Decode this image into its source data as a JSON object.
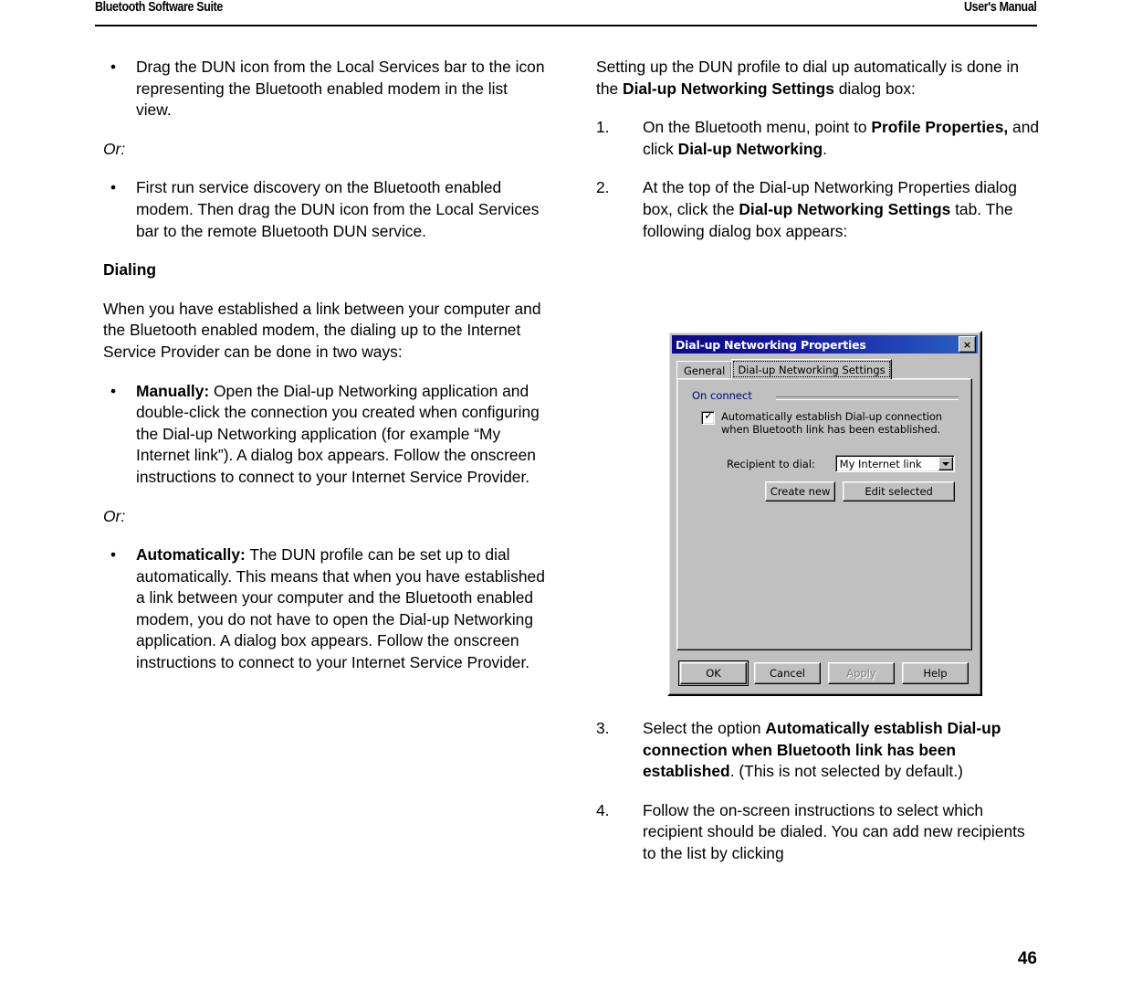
{
  "header": {
    "left_title": "Bluetooth Software Suite",
    "right_title": "User's Manual"
  },
  "left_column": {
    "bullet_1": "Drag the DUN icon from the Local Services bar to the icon representing the Bluetooth enabled modem in the list view.",
    "or_1": "Or:",
    "bullet_2": "First run service discovery on the Bluetooth enabled modem. Then drag the DUN icon from the Local Services bar to the remote Bluetooth DUN service.",
    "heading_dialing": "Dialing",
    "para_intro": "When you have established a link between your computer and the Bluetooth enabled modem, the dialing up to the Internet Service Provider can be done in two ways:",
    "bullet_manually_lead": "Manually:",
    "bullet_manually_rest": " Open the Dial-up Networking application and double-click the connection you created when configuring the Dial-up Networking application (for example “My Internet link”). A dialog box appears. Follow the onscreen instructions to connect to your Internet Service Provider.",
    "or_2": "Or:",
    "bullet_auto_lead": "Automatically:",
    "bullet_auto_rest": " The DUN profile can be set up to dial automatically. This means that when you have established a link between your computer and the Bluetooth enabled modem, you do not have to open the Dial-up Networking application. A dialog box appears. Follow the onscreen instructions to connect to your Internet Service Provider."
  },
  "right_column": {
    "para_intro_a": "Setting up the DUN profile to dial up automatically is done in the ",
    "para_intro_b": "Dial-up Networking Settings",
    "para_intro_c": " dialog box:",
    "step_1": {
      "number": "1.",
      "a": "On the Bluetooth menu, point to ",
      "b": "Profile Properties,",
      "c": " and click ",
      "d": "Dial-up Networking",
      "e": "."
    },
    "step_2": {
      "number": "2.",
      "a": "At the top of the Dial-up Networking Properties dialog box, click the ",
      "b": "Dial-up Networking Settings",
      "c": " tab. The following dialog box appears:"
    },
    "step_3": {
      "number": "3.",
      "a": "Select the option ",
      "b": "Automatically establish Dial-up connection when Bluetooth link has been established",
      "c": ". (This is not selected by default.)"
    },
    "step_4": {
      "number": "4.",
      "a": "Follow the on-screen instructions to select which recipient should be dialed. You can add new recipients to the list by clicking"
    }
  },
  "dialog": {
    "title": "Dial-up Networking Properties",
    "close_label": "×",
    "tabs": [
      {
        "label": "General",
        "selected": false
      },
      {
        "label": "Dial-up Networking Settings",
        "selected": true
      }
    ],
    "group_label": "On connect",
    "checkbox": {
      "label": "Automatically establish Dial-up connection when Bluetooth link has been established.",
      "checked": true,
      "tick": "✓"
    },
    "recipient_label": "Recipient to dial:",
    "recipient_value": "My Internet link",
    "btn_create_new": "Create new",
    "btn_edit_selected": "Edit selected",
    "btn_ok": "OK",
    "btn_cancel": "Cancel",
    "btn_apply": "Apply",
    "btn_help": "Help",
    "colors": {
      "face": "#c0c0c0",
      "titlebar_start": "#0a0a8c",
      "titlebar_end": "#2b63c4",
      "group_label": "#000080",
      "disabled_text": "#808080"
    }
  },
  "footer": {
    "page_number": "46"
  }
}
